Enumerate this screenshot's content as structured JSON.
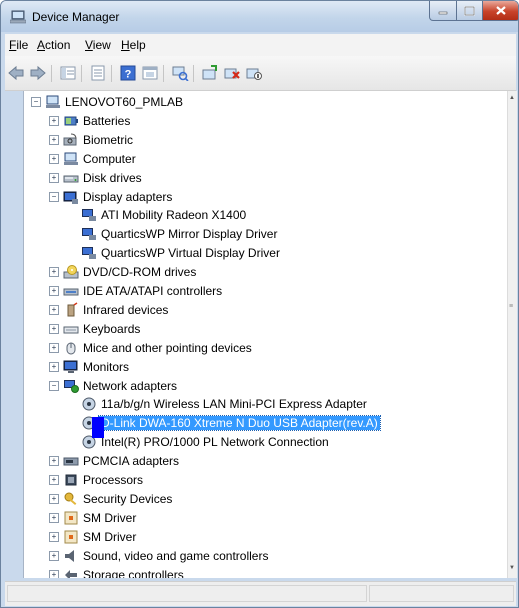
{
  "window": {
    "title": "Device Manager"
  },
  "menu": {
    "items": [
      "File",
      "Action",
      "View",
      "Help"
    ],
    "accelerators": [
      "F",
      "A",
      "V",
      "H"
    ]
  },
  "toolbar": {
    "buttons": [
      "back-icon",
      "forward-icon",
      "show-hide-tree-icon",
      "properties-icon",
      "help-icon",
      "console-icon",
      "scan-hardware-icon",
      "update-driver-icon",
      "uninstall-icon",
      "disable-icon"
    ]
  },
  "tree": {
    "root": "LENOVOT60_PMLAB",
    "categories": [
      {
        "label": "Batteries",
        "expanded": false,
        "icon": "battery-icon"
      },
      {
        "label": "Biometric",
        "expanded": false,
        "icon": "fingerprint-icon"
      },
      {
        "label": "Computer",
        "expanded": false,
        "icon": "computer-icon"
      },
      {
        "label": "Disk drives",
        "expanded": false,
        "icon": "disk-drive-icon"
      },
      {
        "label": "Display adapters",
        "expanded": true,
        "icon": "display-adapter-icon",
        "children": [
          "ATI Mobility Radeon X1400",
          "QuarticsWP Mirror Display Driver",
          "QuarticsWP Virtual Display Driver"
        ]
      },
      {
        "label": "DVD/CD-ROM drives",
        "expanded": false,
        "icon": "dvd-drive-icon"
      },
      {
        "label": "IDE ATA/ATAPI controllers",
        "expanded": false,
        "icon": "ide-controller-icon"
      },
      {
        "label": "Infrared devices",
        "expanded": false,
        "icon": "infrared-icon"
      },
      {
        "label": "Keyboards",
        "expanded": false,
        "icon": "keyboard-icon"
      },
      {
        "label": "Mice and other pointing devices",
        "expanded": false,
        "icon": "mouse-icon"
      },
      {
        "label": "Monitors",
        "expanded": false,
        "icon": "monitor-icon"
      },
      {
        "label": "Network adapters",
        "expanded": true,
        "icon": "network-adapter-icon",
        "children": [
          "11a/b/g/n Wireless LAN Mini-PCI Express Adapter",
          "D-Link DWA-160 Xtreme N Duo USB Adapter(rev.A)",
          "Intel(R) PRO/1000 PL Network Connection"
        ]
      },
      {
        "label": "PCMCIA adapters",
        "expanded": false,
        "icon": "pcmcia-icon"
      },
      {
        "label": "Processors",
        "expanded": false,
        "icon": "processor-icon"
      },
      {
        "label": "Security Devices",
        "expanded": false,
        "icon": "security-key-icon"
      },
      {
        "label": "SM Driver",
        "expanded": false,
        "icon": "sm-driver-icon"
      },
      {
        "label": "SM Driver",
        "expanded": false,
        "icon": "sm-driver-icon"
      },
      {
        "label": "Sound, video and game controllers",
        "expanded": false,
        "icon": "speaker-icon"
      },
      {
        "label": "Storage controllers",
        "expanded": false,
        "icon": "storage-controller-icon"
      }
    ],
    "selected": "D-Link DWA-160 Xtreme N Duo USB Adapter(rev.A)"
  },
  "colors": {
    "selection": "#3399ff",
    "marker": "#0000ff"
  }
}
